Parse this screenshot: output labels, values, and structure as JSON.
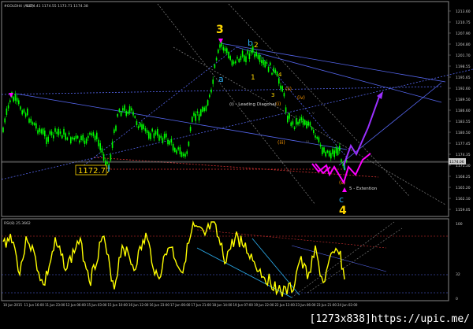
{
  "chart": {
    "symbol_label": "#GOLDH4 (AUD)",
    "symbol_info": "1174.41 1174.55 1173.71 1174.38",
    "current_price_tag": "1174.06",
    "y_axis_prices": [
      "1213.60",
      "1210.75",
      "1207.90",
      "1204.80",
      "1201.70",
      "1198.55",
      "1195.65",
      "1192.60",
      "1189.50",
      "1186.60",
      "1183.55",
      "1180.50",
      "1177.45",
      "1174.35",
      "1171.30",
      "1168.25",
      "1165.20",
      "1162.10",
      "1159.05"
    ],
    "x_axis_dates": [
      "10 Jun 2015",
      "11 Jun 16:00",
      "11 Jun 23:00",
      "12 Jun 06:00",
      "15 Jun 03:00",
      "15 Jun 10:00",
      "16 Jun 12:00",
      "16 Jun 23:00",
      "17 Jun 06:00",
      "17 Jun 21:00",
      "18 Jun 14:00",
      "19 Jun 07:00",
      "19 Jun 22:00",
      "22 Jun 13:00",
      "23 Jun 06:00",
      "23 Jun 21:00",
      "24 Jun 02:00"
    ],
    "price_box": "1172.77",
    "wave_labels": {
      "w3": "3",
      "w4": "4",
      "wa": "a",
      "wb": "b",
      "wc": "c",
      "w2": "2",
      "w1": "1",
      "w3small": "3",
      "w4small": "4",
      "wi": "(i)",
      "wii": "(ii)",
      "wiii": "(iii)",
      "wiv": "(iv)",
      "wv": "(v)",
      "wvsmall": "v",
      "wiiismall": "iii",
      "wismall": "i",
      "leading_diagonal": "(i) - Leading Diagonal",
      "extension": "5 - Extention"
    },
    "colors": {
      "candles": "#00ff00",
      "rsi_line": "#ffff00",
      "wave_major": "#ffd700",
      "wave_abc": "#2aa7e6",
      "wave_minor": "#ff9900",
      "projection_up": "#9b30ff",
      "projection_down": "#ff00ff"
    }
  },
  "rsi": {
    "label": "RSI(8) 25.3662",
    "scale_top": "100",
    "scale_mid": "32",
    "scale_bottom": "0"
  },
  "watermark": "[1273x838]https://upic.me/"
}
